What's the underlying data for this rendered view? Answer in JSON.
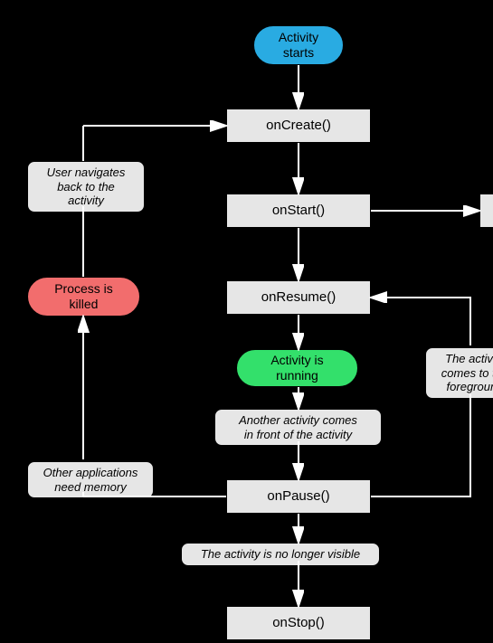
{
  "nodes": {
    "activity_starts": "Activity\nstarts",
    "on_create": "onCreate()",
    "on_start": "onStart()",
    "on_resume": "onResume()",
    "activity_running": "Activity is\nrunning",
    "on_pause": "onPause()",
    "on_stop": "onStop()",
    "process_killed": "Process is\nkilled"
  },
  "labels": {
    "user_navigates_back": "User navigates\nback to the\nactivity",
    "other_apps_memory": "Other applications\nneed memory",
    "another_activity_front": "Another activity comes\nin front of the activity",
    "no_longer_visible": "The activity is no longer visible",
    "activity_foreground": "The activity\ncomes to the\nforeground",
    "partial_right": ""
  }
}
